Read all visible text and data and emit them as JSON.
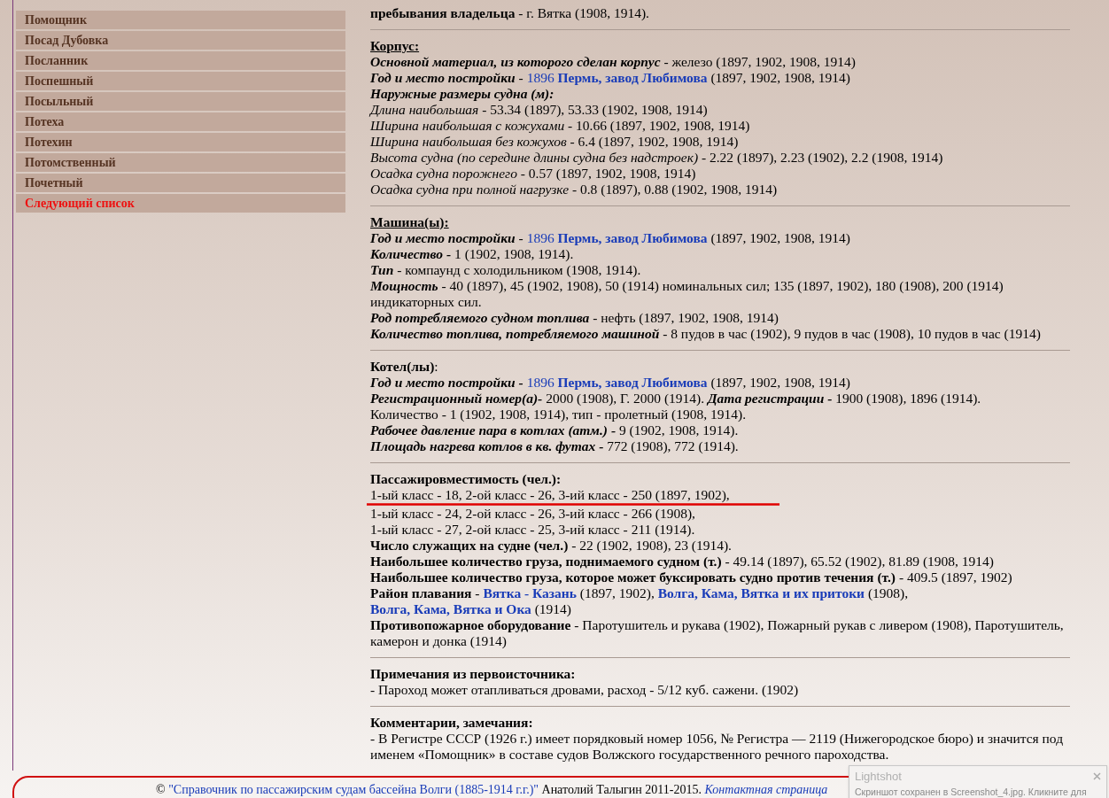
{
  "sidebar": {
    "items": [
      {
        "label": "Помощник",
        "kind": "ship"
      },
      {
        "label": "Посад Дубовка",
        "kind": "ship"
      },
      {
        "label": "Посланник",
        "kind": "ship"
      },
      {
        "label": "Поспешный",
        "kind": "ship"
      },
      {
        "label": "Посыльный",
        "kind": "ship"
      },
      {
        "label": "Потеха",
        "kind": "ship"
      },
      {
        "label": "Потехин",
        "kind": "ship"
      },
      {
        "label": "Потомственный",
        "kind": "ship"
      },
      {
        "label": "Почетный",
        "kind": "ship"
      },
      {
        "label": "Следующий список",
        "kind": "next"
      }
    ]
  },
  "sections": [
    {
      "lines": [
        [
          {
            "kind": "b",
            "text": "пребывания владельца"
          },
          {
            "kind": "n",
            "text": " - г. Вятка (1908, 1914)."
          }
        ]
      ]
    },
    {
      "lines": [
        [
          {
            "kind": "bu",
            "text": "Корпус:"
          }
        ],
        [
          {
            "kind": "bi",
            "text": "Основной материал, из которого сделан корпус"
          },
          {
            "kind": "n",
            "text": " - железо (1897, 1902, 1908, 1914)"
          }
        ],
        [
          {
            "kind": "bi",
            "text": "Год и место постройки"
          },
          {
            "kind": "n",
            "text": " - "
          },
          {
            "kind": "link",
            "text": "1896 **Пермь, завод Любимова**"
          },
          {
            "kind": "n",
            "text": " (1897, 1902, 1908, 1914)"
          }
        ],
        [
          {
            "kind": "bi",
            "text": "Наружные размеры судна (м):"
          }
        ],
        [
          {
            "kind": "i",
            "text": "Длина наибольшая"
          },
          {
            "kind": "n",
            "text": " - 53.34 (1897), 53.33 (1902, 1908, 1914)"
          }
        ],
        [
          {
            "kind": "i",
            "text": "Ширина наибольшая с кожухами"
          },
          {
            "kind": "n",
            "text": " - 10.66 (1897, 1902, 1908, 1914)"
          }
        ],
        [
          {
            "kind": "i",
            "text": "Ширина наибольшая без кожухов"
          },
          {
            "kind": "n",
            "text": " - 6.4 (1897, 1902, 1908, 1914)"
          }
        ],
        [
          {
            "kind": "i",
            "text": "Высота судна (по середине длины судна без надстроек)"
          },
          {
            "kind": "n",
            "text": " - 2.22 (1897), 2.23 (1902), 2.2 (1908, 1914)"
          }
        ],
        [
          {
            "kind": "i",
            "text": "Осадка судна порожнего"
          },
          {
            "kind": "n",
            "text": " - 0.57 (1897, 1902, 1908, 1914)"
          }
        ],
        [
          {
            "kind": "i",
            "text": "Осадка судна при полной нагрузке"
          },
          {
            "kind": "n",
            "text": " - 0.8 (1897), 0.88 (1902, 1908, 1914)"
          }
        ]
      ]
    },
    {
      "lines": [
        [
          {
            "kind": "bu",
            "text": "Машина(ы):"
          }
        ],
        [
          {
            "kind": "bi",
            "text": "Год и место постройки"
          },
          {
            "kind": "n",
            "text": " - "
          },
          {
            "kind": "link",
            "text": "1896 **Пермь, завод Любимова**"
          },
          {
            "kind": "n",
            "text": " (1897, 1902, 1908, 1914)"
          }
        ],
        [
          {
            "kind": "bi",
            "text": "Количество -"
          },
          {
            "kind": "n",
            "text": " 1 (1902, 1908, 1914)."
          }
        ],
        [
          {
            "kind": "bi",
            "text": "Тип"
          },
          {
            "kind": "n",
            "text": " - компаунд с холодильником (1908, 1914)."
          }
        ],
        [
          {
            "kind": "bi",
            "text": "Мощность"
          },
          {
            "kind": "n",
            "text": " - 40 (1897), 45 (1902, 1908), 50 (1914) номинальных сил; 135 (1897, 1902), 180 (1908), 200 (1914) индикаторных сил."
          }
        ],
        [
          {
            "kind": "bi",
            "text": "Род потребляемого судном топлива"
          },
          {
            "kind": "n",
            "text": " - нефть (1897, 1902, 1908, 1914)"
          }
        ],
        [
          {
            "kind": "bi",
            "text": "Количество топлива, потребляемого машиной"
          },
          {
            "kind": "n",
            "text": " - 8 пудов в час (1902), 9 пудов в час (1908), 10 пудов в час (1914)"
          }
        ]
      ]
    },
    {
      "lines": [
        [
          {
            "kind": "b",
            "text": "Котел(лы)"
          },
          {
            "kind": "n",
            "text": ":"
          }
        ],
        [
          {
            "kind": "bi",
            "text": "Год и место постройки - "
          },
          {
            "kind": "link",
            "text": "1896 **Пермь, завод Любимова**"
          },
          {
            "kind": "n",
            "text": " (1897, 1902, 1908, 1914)"
          }
        ],
        [
          {
            "kind": "bi",
            "text": "Регистрационный номер(а)-"
          },
          {
            "kind": "n",
            "text": " 2000 (1908), Г. 2000 (1914). "
          },
          {
            "kind": "bi",
            "text": "Дата регистрации -"
          },
          {
            "kind": "n",
            "text": " 1900 (1908), 1896 (1914)."
          }
        ],
        [
          {
            "kind": "n",
            "text": "Количество - 1 (1902, 1908, 1914), тип - пролетный (1908, 1914)."
          }
        ],
        [
          {
            "kind": "bi",
            "text": "Рабочее давление пара в котлах (атм.) -"
          },
          {
            "kind": "n",
            "text": " 9 (1902, 1908, 1914)."
          }
        ],
        [
          {
            "kind": "bi",
            "text": "Площадь нагрева котлов в кв. футах -"
          },
          {
            "kind": "n",
            "text": " 772 (1908), 772 (1914)."
          }
        ]
      ]
    },
    {
      "lines": [
        [
          {
            "kind": "b",
            "text": "Пассажировместимость (чел.):"
          }
        ],
        [
          {
            "kind": "n",
            "text": "1-ый класс - 18, 2-ой класс - 26, 3-ий класс - 250 (1897, 1902),"
          }
        ],
        [
          {
            "kind": "n",
            "text": "1-ый класс - 24, 2-ой класс - 26, 3-ий класс - 266 (1908),"
          }
        ],
        [
          {
            "kind": "n",
            "text": "1-ый класс - 27, 2-ой класс - 25, 3-ий класс - 211 (1914)."
          }
        ],
        [
          {
            "kind": "b",
            "text": "Число служащих на судне (чел.)"
          },
          {
            "kind": "n",
            "text": " - 22 (1902, 1908), 23 (1914)."
          }
        ],
        [
          {
            "kind": "b",
            "text": "Наибольшее количество груза, поднимаемого судном (т.)"
          },
          {
            "kind": "n",
            "text": " - 49.14 (1897), 65.52 (1902), 81.89 (1908, 1914)"
          }
        ],
        [
          {
            "kind": "b",
            "text": "Наибольшее количество груза, которое может буксировать судно против течения (т.)"
          },
          {
            "kind": "n",
            "text": " - 409.5 (1897, 1902)"
          }
        ],
        [
          {
            "kind": "b",
            "text": "Район плавания"
          },
          {
            "kind": "n",
            "text": " - "
          },
          {
            "kind": "link",
            "text": "**Вятка - Казань**"
          },
          {
            "kind": "n",
            "text": " (1897, 1902), "
          },
          {
            "kind": "link",
            "text": "**Волга, Кама, Вятка и их притоки**"
          },
          {
            "kind": "n",
            "text": " (1908), "
          },
          {
            "kind": "link",
            "text": "**Волга, Кама, Вятка и Ока**"
          },
          {
            "kind": "n",
            "text": " (1914)"
          }
        ],
        [
          {
            "kind": "b",
            "text": "Противопожарное оборудование"
          },
          {
            "kind": "n",
            "text": " - Паротушитель и рукава (1902), Пожарный рукав с ливером (1908), Паротушитель, камерон и донка (1914)"
          }
        ]
      ]
    },
    {
      "lines": [
        [
          {
            "kind": "b",
            "text": "Примечания из первоисточника:"
          }
        ],
        [
          {
            "kind": "n",
            "text": "- Пароход может отапливаться дровами, расход - 5/12 куб. сажени. (1902)"
          }
        ]
      ]
    },
    {
      "lines": [
        [
          {
            "kind": "b",
            "text": "Комментарии, замечания:"
          }
        ],
        [
          {
            "kind": "n",
            "text": "- В Регистре СССР (1926 г.) имеет порядковый номер 1056, № Регистра — 2119 (Нижегородское бюро) и значится под именем «Помощник» в составе судов Волжского государственного речного пароходства."
          }
        ]
      ]
    }
  ],
  "footer": {
    "copyright": "©",
    "book_link": "\"Справочник по пассажирским судам бассейна Волги (1885-1914 г.г.)\"",
    "author": "Анатолий Талыгин 2011-2015.",
    "contact_link": "Контактная страница"
  },
  "notification": {
    "title": "Lightshot",
    "message": "Скриншот сохранен в Screenshot_4.jpg. Кликните для"
  }
}
